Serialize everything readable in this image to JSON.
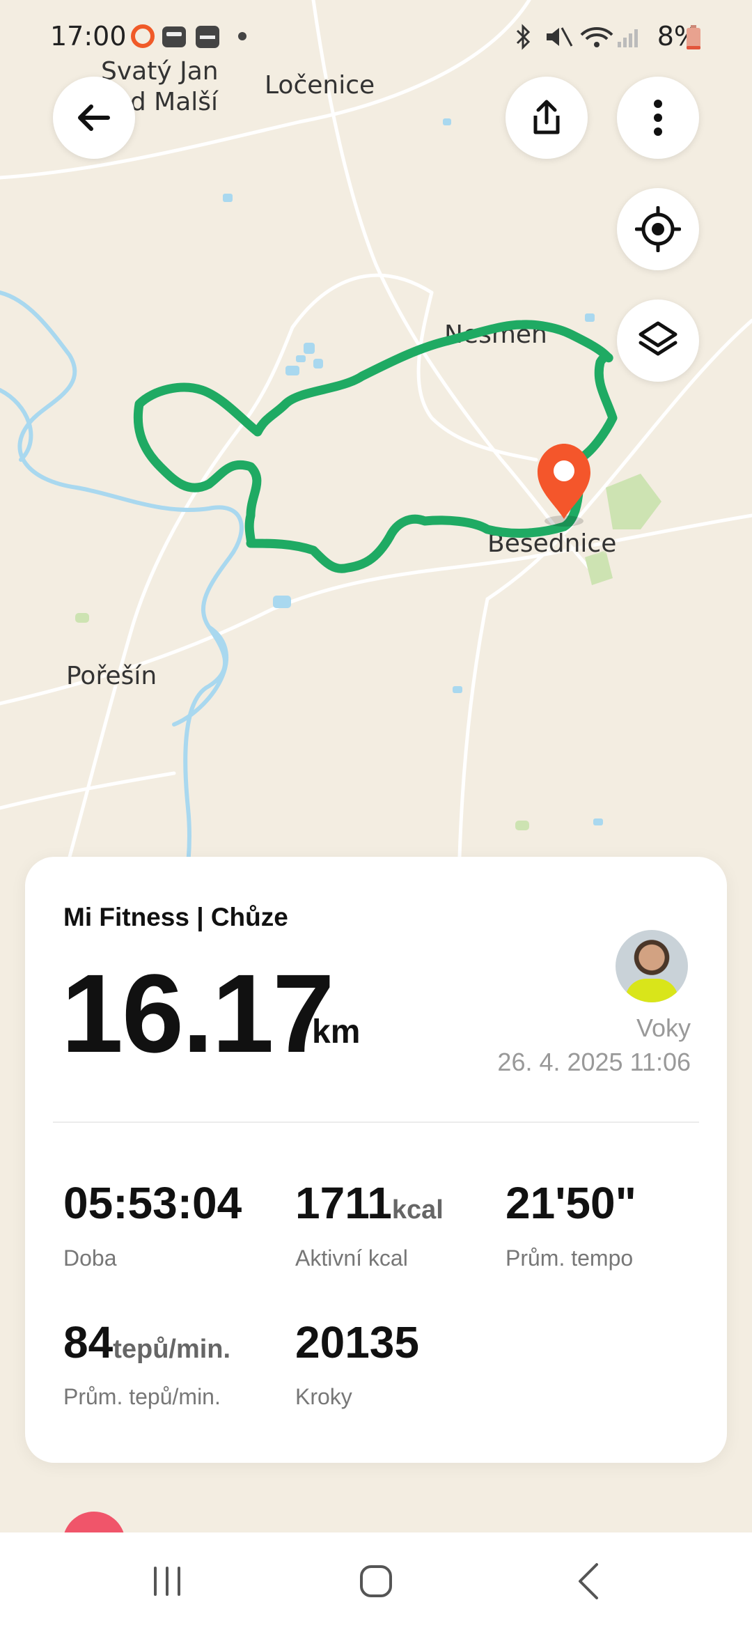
{
  "status_bar": {
    "time": "17:00",
    "battery": "8%"
  },
  "map": {
    "labels": [
      "Svatý Jan",
      "nad Malší",
      "Ločenice",
      "Nesměň",
      "Besednice",
      "Pořešín"
    ],
    "route_color": "#1faa63",
    "pin_color": "#f4562b"
  },
  "workout": {
    "title": "Mi Fitness | Chůze",
    "distance": "16.17",
    "distance_unit": "km",
    "user_name": "Voky",
    "date": "26. 4. 2025 11:06",
    "stats": [
      {
        "value": "05:53:04",
        "unit": "",
        "label": "Doba"
      },
      {
        "value": "1711",
        "unit": "kcal",
        "label": "Aktivní kcal"
      },
      {
        "value": "21'50\"",
        "unit": "",
        "label": "Prům. tempo"
      },
      {
        "value": "84",
        "unit": "tepů/min.",
        "label": "Prům. tepů/min."
      },
      {
        "value": "20135",
        "unit": "",
        "label": "Kroky"
      }
    ]
  },
  "icons": [
    "back-arrow-icon",
    "share-icon",
    "more-vertical-icon",
    "locate-icon",
    "layers-icon",
    "recents-icon",
    "home-icon",
    "back-nav-icon"
  ]
}
